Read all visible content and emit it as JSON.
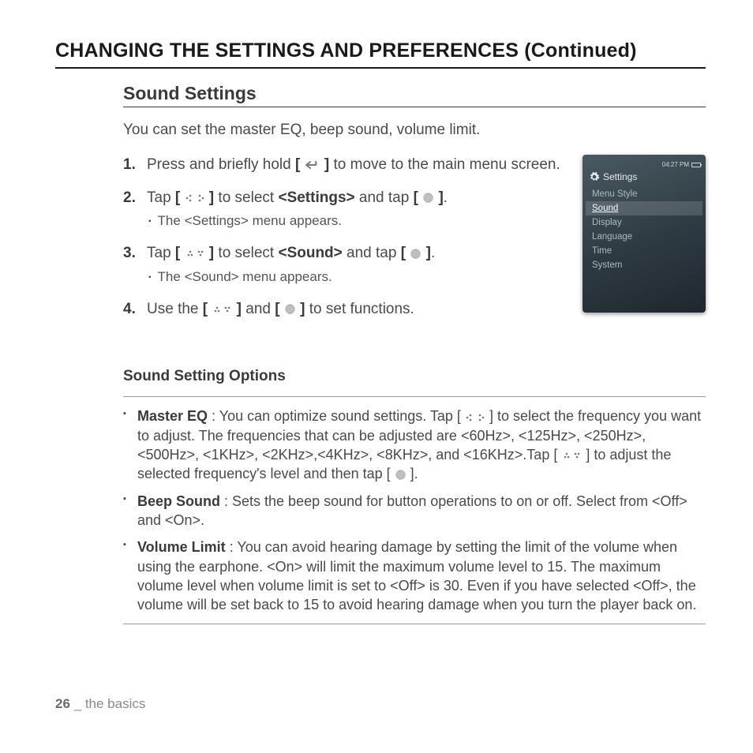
{
  "title": "CHANGING THE SETTINGS AND PREFERENCES (Continued)",
  "section_title": "Sound Settings",
  "intro": "You can set the master EQ, beep sound, volume limit.",
  "steps": [
    {
      "parts": [
        "Press and briefly hold ",
        "icon:back",
        " to move to the main menu screen."
      ],
      "sub": null
    },
    {
      "parts": [
        "Tap ",
        "icon:lr-light",
        " to select ",
        "bold:<Settings>",
        " and tap ",
        "icon:circle",
        "."
      ],
      "sub": "The <Settings> menu appears."
    },
    {
      "parts": [
        "Tap ",
        "icon:ud",
        " to select ",
        "bold:<Sound>",
        " and tap ",
        "icon:circle",
        "."
      ],
      "sub": "The <Sound> menu appears."
    },
    {
      "parts": [
        "Use the ",
        "icon:ud",
        " and ",
        "icon:circle",
        " to set functions."
      ],
      "sub": null
    }
  ],
  "device": {
    "time": "04:27 PM",
    "header": "Settings",
    "items": [
      "Menu Style",
      "Sound",
      "Display",
      "Language",
      "Time",
      "System"
    ],
    "selected_index": 1
  },
  "options_title": "Sound Setting Options",
  "options": [
    {
      "name": "Master EQ",
      "parts": [
        " : You can optimize sound settings. Tap [ ",
        "icon:lr-light-plain",
        " ] to select the frequency you want to adjust. The frequencies that can be adjusted are <60Hz>, <125Hz>, <250Hz>, <500Hz>, <1KHz>, <2KHz>,<4KHz>, <8KHz>, and <16KHz>.Tap [ ",
        "icon:ud-plain",
        " ] to adjust the selected frequency's level and then tap [ ",
        "icon:circle-plain",
        " ]."
      ]
    },
    {
      "name": "Beep Sound",
      "parts": [
        " : Sets the beep sound for button operations to on or off. Select from <Off> and <On>."
      ]
    },
    {
      "name": "Volume Limit",
      "parts": [
        " : You can avoid hearing damage by setting the limit of the volume when using the earphone. <On> will limit the maximum volume level to 15. The maximum volume level when volume limit is set to <Off> is 30. Even if you have selected <Off>, the volume will be set back to 15 to avoid hearing damage when you turn the player back on."
      ]
    }
  ],
  "footer": {
    "page": "26",
    "sep": " _ ",
    "chapter": "the basics"
  }
}
